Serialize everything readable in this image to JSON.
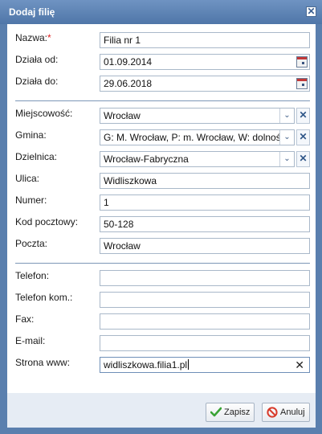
{
  "dialog": {
    "title": "Dodaj filię",
    "close_glyph": "✕"
  },
  "form": {
    "nazwa": {
      "label": "Nazwa:",
      "required_mark": "*",
      "value": "Filia nr 1"
    },
    "dziala_od": {
      "label": "Działa od:",
      "value": "01.09.2014"
    },
    "dziala_do": {
      "label": "Działa do:",
      "value": "29.06.2018"
    },
    "miejscowosc": {
      "label": "Miejscowość:",
      "value": "Wrocław"
    },
    "gmina": {
      "label": "Gmina:",
      "value": "G: M. Wrocław, P: m. Wrocław, W: dolnośląskie"
    },
    "dzielnica": {
      "label": "Dzielnica:",
      "value": "Wrocław-Fabryczna"
    },
    "ulica": {
      "label": "Ulica:",
      "value": "Widliszkowa"
    },
    "numer": {
      "label": "Numer:",
      "value": "1"
    },
    "kod_pocztowy": {
      "label": "Kod pocztowy:",
      "value": "50-128"
    },
    "poczta": {
      "label": "Poczta:",
      "value": "Wrocław"
    },
    "telefon": {
      "label": "Telefon:",
      "value": ""
    },
    "telefon_kom": {
      "label": "Telefon kom.:",
      "value": ""
    },
    "fax": {
      "label": "Fax:",
      "value": ""
    },
    "email": {
      "label": "E-mail:",
      "value": ""
    },
    "strona_www": {
      "label": "Strona www:",
      "value": "widliszkowa.filia1.pl"
    }
  },
  "glyphs": {
    "dropdown": "⌄",
    "clear": "✕"
  },
  "buttons": {
    "save": "Zapisz",
    "cancel": "Anuluj"
  },
  "icons": {
    "calendar": "calendar-icon",
    "save": "checkmark-icon",
    "cancel": "no-entry-icon"
  },
  "colors": {
    "title_bar": "#5a7fae",
    "required": "#e02020",
    "save_check": "#3aa335",
    "cancel_icon": "#d83a2a"
  }
}
